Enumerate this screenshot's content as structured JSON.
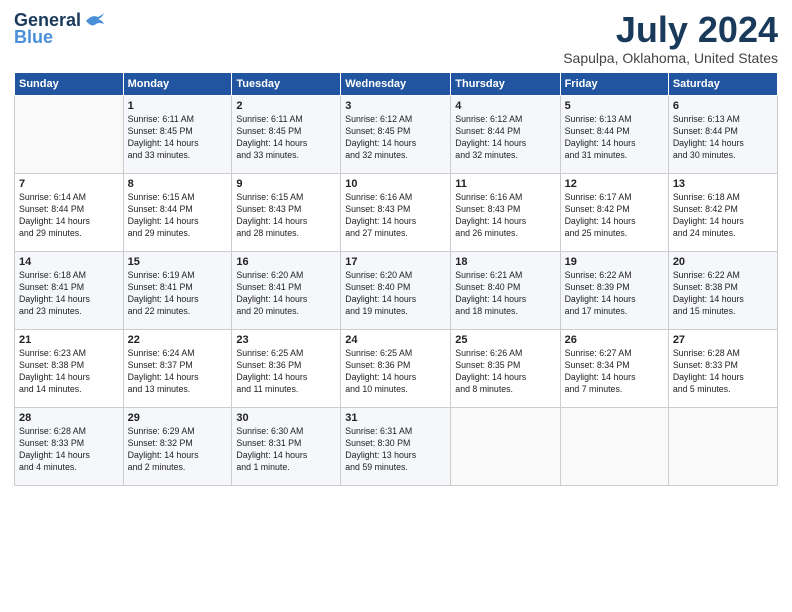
{
  "header": {
    "logo_general": "General",
    "logo_blue": "Blue",
    "month": "July 2024",
    "location": "Sapulpa, Oklahoma, United States"
  },
  "days_of_week": [
    "Sunday",
    "Monday",
    "Tuesday",
    "Wednesday",
    "Thursday",
    "Friday",
    "Saturday"
  ],
  "weeks": [
    [
      {
        "day": "",
        "info": ""
      },
      {
        "day": "1",
        "info": "Sunrise: 6:11 AM\nSunset: 8:45 PM\nDaylight: 14 hours\nand 33 minutes."
      },
      {
        "day": "2",
        "info": "Sunrise: 6:11 AM\nSunset: 8:45 PM\nDaylight: 14 hours\nand 33 minutes."
      },
      {
        "day": "3",
        "info": "Sunrise: 6:12 AM\nSunset: 8:45 PM\nDaylight: 14 hours\nand 32 minutes."
      },
      {
        "day": "4",
        "info": "Sunrise: 6:12 AM\nSunset: 8:44 PM\nDaylight: 14 hours\nand 32 minutes."
      },
      {
        "day": "5",
        "info": "Sunrise: 6:13 AM\nSunset: 8:44 PM\nDaylight: 14 hours\nand 31 minutes."
      },
      {
        "day": "6",
        "info": "Sunrise: 6:13 AM\nSunset: 8:44 PM\nDaylight: 14 hours\nand 30 minutes."
      }
    ],
    [
      {
        "day": "7",
        "info": "Sunrise: 6:14 AM\nSunset: 8:44 PM\nDaylight: 14 hours\nand 29 minutes."
      },
      {
        "day": "8",
        "info": "Sunrise: 6:15 AM\nSunset: 8:44 PM\nDaylight: 14 hours\nand 29 minutes."
      },
      {
        "day": "9",
        "info": "Sunrise: 6:15 AM\nSunset: 8:43 PM\nDaylight: 14 hours\nand 28 minutes."
      },
      {
        "day": "10",
        "info": "Sunrise: 6:16 AM\nSunset: 8:43 PM\nDaylight: 14 hours\nand 27 minutes."
      },
      {
        "day": "11",
        "info": "Sunrise: 6:16 AM\nSunset: 8:43 PM\nDaylight: 14 hours\nand 26 minutes."
      },
      {
        "day": "12",
        "info": "Sunrise: 6:17 AM\nSunset: 8:42 PM\nDaylight: 14 hours\nand 25 minutes."
      },
      {
        "day": "13",
        "info": "Sunrise: 6:18 AM\nSunset: 8:42 PM\nDaylight: 14 hours\nand 24 minutes."
      }
    ],
    [
      {
        "day": "14",
        "info": "Sunrise: 6:18 AM\nSunset: 8:41 PM\nDaylight: 14 hours\nand 23 minutes."
      },
      {
        "day": "15",
        "info": "Sunrise: 6:19 AM\nSunset: 8:41 PM\nDaylight: 14 hours\nand 22 minutes."
      },
      {
        "day": "16",
        "info": "Sunrise: 6:20 AM\nSunset: 8:41 PM\nDaylight: 14 hours\nand 20 minutes."
      },
      {
        "day": "17",
        "info": "Sunrise: 6:20 AM\nSunset: 8:40 PM\nDaylight: 14 hours\nand 19 minutes."
      },
      {
        "day": "18",
        "info": "Sunrise: 6:21 AM\nSunset: 8:40 PM\nDaylight: 14 hours\nand 18 minutes."
      },
      {
        "day": "19",
        "info": "Sunrise: 6:22 AM\nSunset: 8:39 PM\nDaylight: 14 hours\nand 17 minutes."
      },
      {
        "day": "20",
        "info": "Sunrise: 6:22 AM\nSunset: 8:38 PM\nDaylight: 14 hours\nand 15 minutes."
      }
    ],
    [
      {
        "day": "21",
        "info": "Sunrise: 6:23 AM\nSunset: 8:38 PM\nDaylight: 14 hours\nand 14 minutes."
      },
      {
        "day": "22",
        "info": "Sunrise: 6:24 AM\nSunset: 8:37 PM\nDaylight: 14 hours\nand 13 minutes."
      },
      {
        "day": "23",
        "info": "Sunrise: 6:25 AM\nSunset: 8:36 PM\nDaylight: 14 hours\nand 11 minutes."
      },
      {
        "day": "24",
        "info": "Sunrise: 6:25 AM\nSunset: 8:36 PM\nDaylight: 14 hours\nand 10 minutes."
      },
      {
        "day": "25",
        "info": "Sunrise: 6:26 AM\nSunset: 8:35 PM\nDaylight: 14 hours\nand 8 minutes."
      },
      {
        "day": "26",
        "info": "Sunrise: 6:27 AM\nSunset: 8:34 PM\nDaylight: 14 hours\nand 7 minutes."
      },
      {
        "day": "27",
        "info": "Sunrise: 6:28 AM\nSunset: 8:33 PM\nDaylight: 14 hours\nand 5 minutes."
      }
    ],
    [
      {
        "day": "28",
        "info": "Sunrise: 6:28 AM\nSunset: 8:33 PM\nDaylight: 14 hours\nand 4 minutes."
      },
      {
        "day": "29",
        "info": "Sunrise: 6:29 AM\nSunset: 8:32 PM\nDaylight: 14 hours\nand 2 minutes."
      },
      {
        "day": "30",
        "info": "Sunrise: 6:30 AM\nSunset: 8:31 PM\nDaylight: 14 hours\nand 1 minute."
      },
      {
        "day": "31",
        "info": "Sunrise: 6:31 AM\nSunset: 8:30 PM\nDaylight: 13 hours\nand 59 minutes."
      },
      {
        "day": "",
        "info": ""
      },
      {
        "day": "",
        "info": ""
      },
      {
        "day": "",
        "info": ""
      }
    ]
  ]
}
